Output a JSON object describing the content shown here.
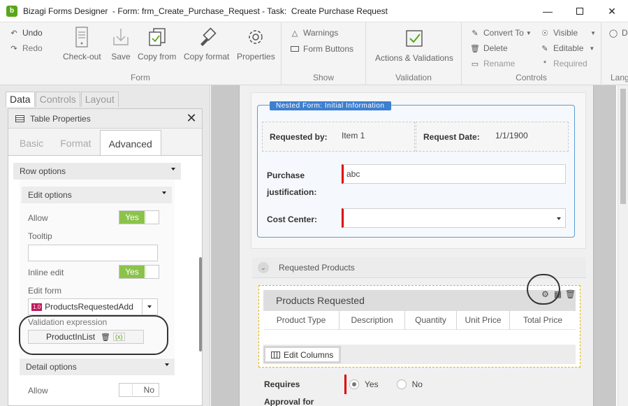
{
  "window": {
    "title": "Bizagi Forms Designer  - Form: frm_Create_Purchase_Request - Task:  Create Purchase Request",
    "logo_letter": "b"
  },
  "ribbon": {
    "undo": "Undo",
    "redo": "Redo",
    "form_group": {
      "label": "Form",
      "checkout": "Check-out",
      "save": "Save",
      "copy_from": "Copy from",
      "copy_format": "Copy format",
      "properties": "Properties"
    },
    "show_group": {
      "label": "Show",
      "warnings": "Warnings",
      "form_buttons": "Form Buttons"
    },
    "validation_group": {
      "label": "Validation",
      "actions": "Actions & Validations"
    },
    "controls_group": {
      "label": "Controls",
      "convert_to": "Convert To",
      "delete": "Delete",
      "rename": "Rename",
      "visible": "Visible",
      "editable": "Editable",
      "required": "Required"
    },
    "overflow_group": {
      "label": "Lang",
      "button": "D"
    }
  },
  "left_panel": {
    "tabs": [
      "Data",
      "Controls",
      "Layout"
    ],
    "table_properties": {
      "title": "Table Properties",
      "tabs": [
        "Basic",
        "Format",
        "Advanced"
      ],
      "row_options": "Row options",
      "edit_options": "Edit options",
      "allow_label": "Allow",
      "allow_value": "Yes",
      "tooltip_label": "Tooltip",
      "inline_edit_label": "Inline edit",
      "inline_edit_value": "Yes",
      "edit_form_label": "Edit form",
      "edit_form_badge": "1.0",
      "edit_form_value": "ProductsRequestedAdd",
      "validation_label": "Validation expression",
      "validation_value": "ProductInList",
      "detail_options": "Detail options",
      "detail_allow_label": "Allow",
      "detail_allow_value": "No"
    }
  },
  "canvas": {
    "nested_form_tag": "Nested Form: Initial Information",
    "requested_by_label": "Requested by:",
    "requested_by_value": "Item 1",
    "request_date_label": "Request Date:",
    "request_date_value": "1/1/1900",
    "purchase_label_1": "Purchase",
    "purchase_label_2": "justification:",
    "purchase_value": "abc",
    "cost_center_label": "Cost Center:",
    "requested_products_group": "Requested Products",
    "grid_title": "Products Requested",
    "grid_columns": [
      "Product Type",
      "Description",
      "Quantity",
      "Unit Price",
      "Total Price"
    ],
    "edit_columns": "Edit Columns",
    "requires_label_1": "Requires",
    "requires_label_2": "Approval for",
    "radio_yes": "Yes",
    "radio_no": "No"
  },
  "colors": {
    "accent_blue": "#3d7fd1",
    "toggle_green": "#8bc34a",
    "required_red": "#e00000",
    "grid_highlight": "#e0b400"
  }
}
